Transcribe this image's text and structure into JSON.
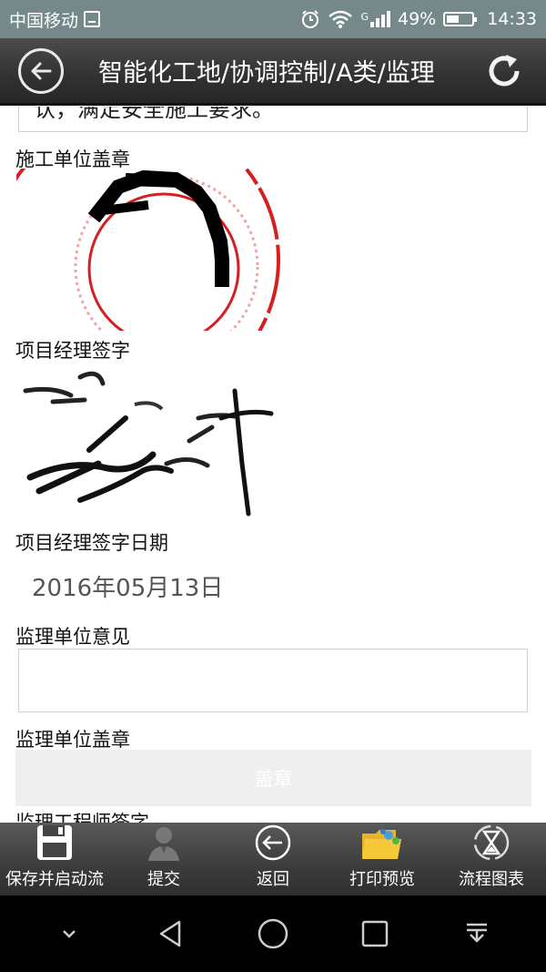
{
  "status_bar": {
    "carrier": "中国移动",
    "network": "G",
    "battery": "49%",
    "time": "14:33"
  },
  "header": {
    "title": "智能化工地/协调控制/A类/监理"
  },
  "form": {
    "previous_field_text": "认，满足安全施工要求。",
    "construction_seal_label": "施工单位盖章",
    "pm_signature_label": "项目经理签字",
    "pm_signature_date_label": "项目经理签字日期",
    "pm_signature_date_value": "2016年05月13日",
    "supervision_opinion_label": "监理单位意见",
    "supervision_opinion_value": "",
    "supervision_seal_label": "监理单位盖章",
    "stamp_button_label": "盖章",
    "next_label": "监理工程师签字"
  },
  "toolbar": {
    "items": [
      {
        "label": "保存并启动流",
        "icon": "save-icon"
      },
      {
        "label": "提交",
        "icon": "user-icon"
      },
      {
        "label": "返回",
        "icon": "back-icon"
      },
      {
        "label": "打印预览",
        "icon": "folder-icon"
      },
      {
        "label": "流程图表",
        "icon": "hourglass-icon"
      }
    ]
  },
  "colors": {
    "status_bar": "#76898a",
    "title_bar": "#333333",
    "seal_red": "#d42020"
  }
}
